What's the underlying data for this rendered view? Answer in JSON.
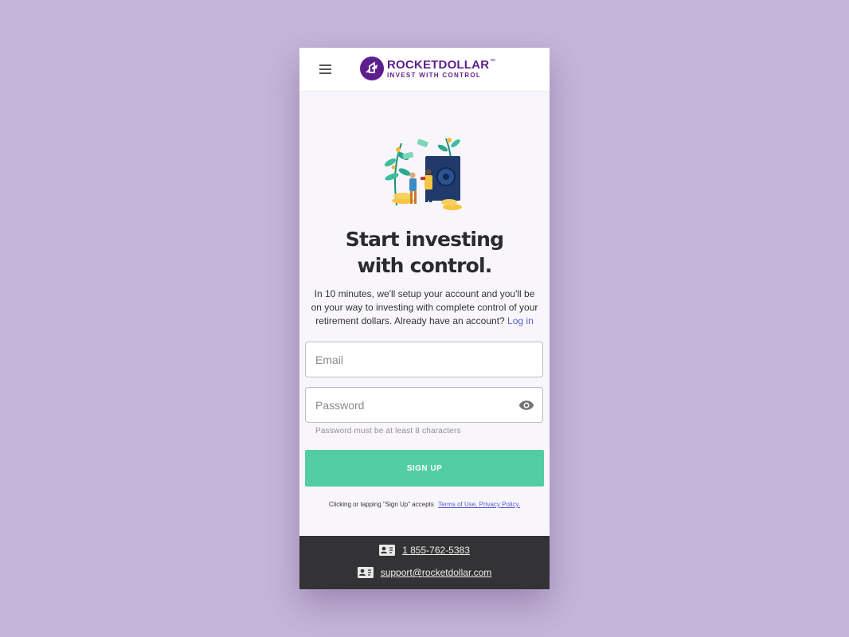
{
  "brand": {
    "name": "ROCKETDOLLAR",
    "trademark": "™",
    "tagline": "INVEST WITH CONTROL",
    "color": "#5d1e8e"
  },
  "hero": {
    "headline_line1": "Start investing",
    "headline_line2": "with control.",
    "description": "In 10 minutes, we'll setup your account and you'll be on your way to investing with complete control of your retirement dollars. Already have an account?",
    "login_link": "Log in"
  },
  "form": {
    "email_placeholder": "Email",
    "password_placeholder": "Password",
    "password_hint": "Password must be at least 8 characters",
    "signup_label": "SIGN UP",
    "signup_color": "#53cda4"
  },
  "terms": {
    "text": "Clicking or tapping \"Sign Up\" accepts",
    "link": "Terms of Use, Privacy Policy."
  },
  "footer": {
    "phone": "1 855-762-5383",
    "email": "support@rocketdollar.com"
  },
  "icons": {
    "menu": "hamburger-menu-icon",
    "password_toggle": "eye-icon",
    "phone": "contact-card-icon",
    "email": "contact-card-icon"
  }
}
